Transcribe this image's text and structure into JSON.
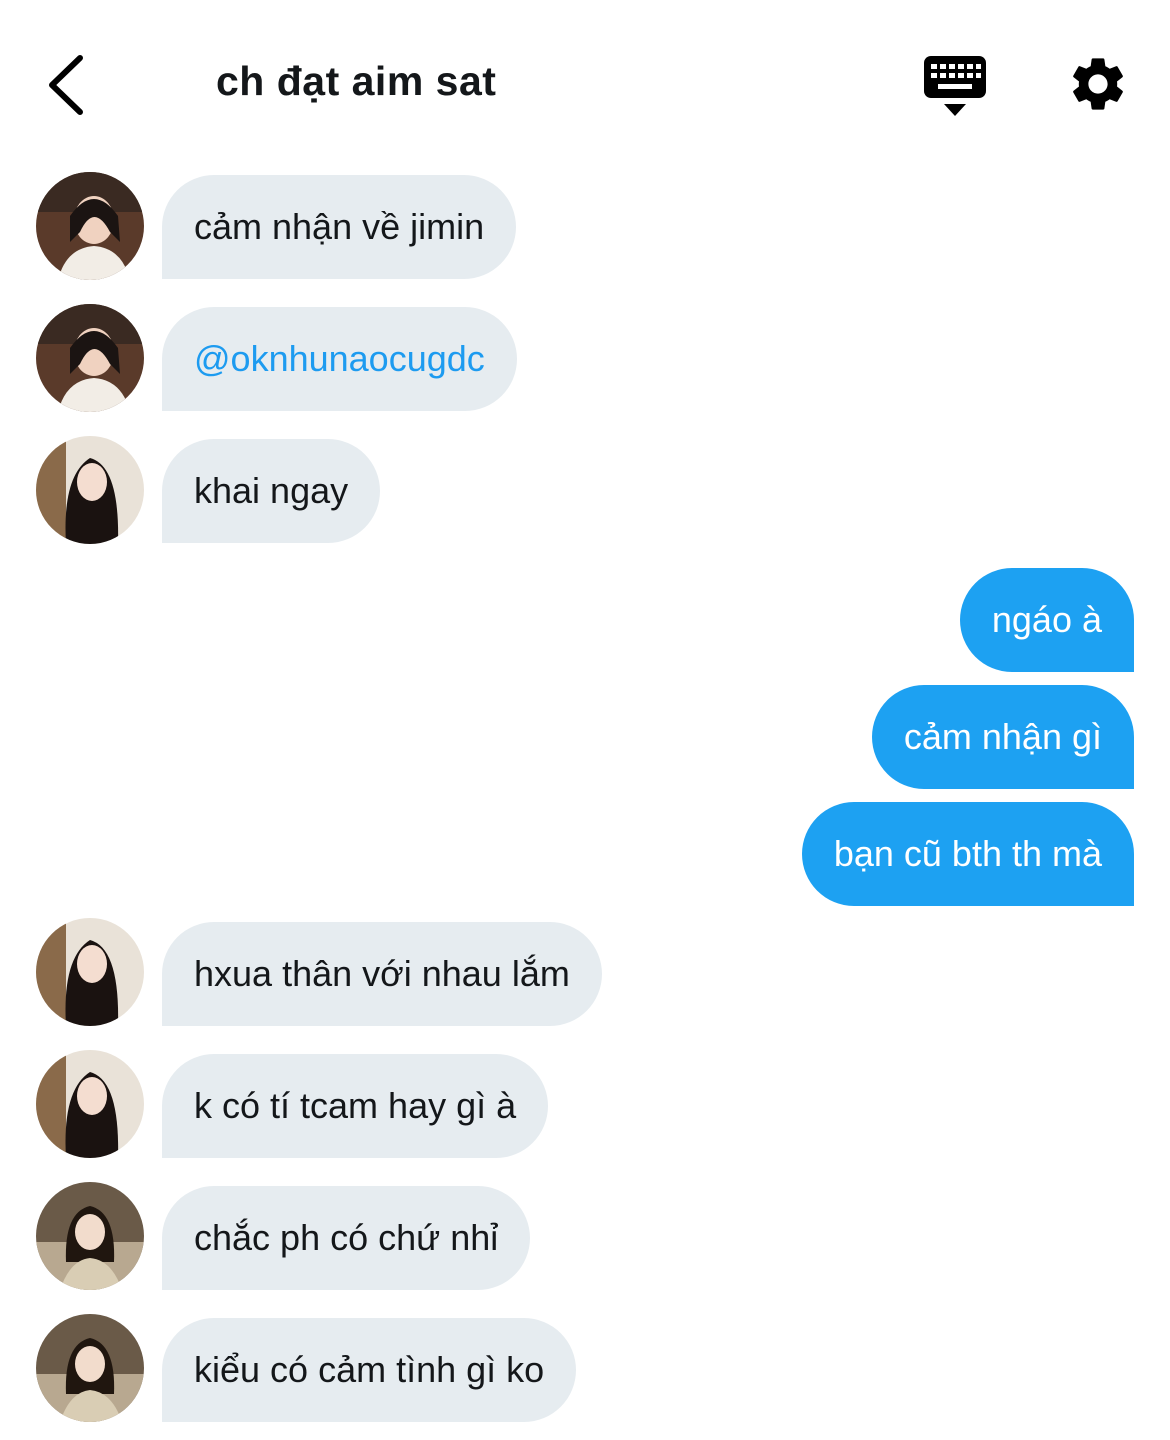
{
  "header": {
    "title": "ch đạt aim sat",
    "back_icon": "chevron-left-icon",
    "keyboard_icon": "keyboard-icon",
    "settings_icon": "gear-icon"
  },
  "colors": {
    "incoming_bubble": "#e6ecf0",
    "outgoing_bubble": "#1da1f2",
    "mention": "#1d9bf0",
    "text": "#14171a"
  },
  "messages": [
    {
      "direction": "incoming",
      "text": "cảm nhận về jimin",
      "avatar": "avatar-1"
    },
    {
      "direction": "incoming",
      "text": "@oknhunaocugdc",
      "avatar": "avatar-1",
      "mention": true
    },
    {
      "direction": "incoming",
      "text": "khai ngay",
      "avatar": "avatar-2"
    },
    {
      "direction": "outgoing",
      "text": "ngáo à"
    },
    {
      "direction": "outgoing",
      "text": "cảm nhận gì"
    },
    {
      "direction": "outgoing",
      "text": "bạn cũ bth th mà"
    },
    {
      "direction": "incoming",
      "text": "hxua thân với nhau lắm",
      "avatar": "avatar-2"
    },
    {
      "direction": "incoming",
      "text": "k có tí tcam hay gì à",
      "avatar": "avatar-2"
    },
    {
      "direction": "incoming",
      "text": "chắc ph có chứ nhỉ",
      "avatar": "avatar-3"
    },
    {
      "direction": "incoming",
      "text": "kiểu có cảm tình gì ko",
      "avatar": "avatar-3"
    }
  ]
}
